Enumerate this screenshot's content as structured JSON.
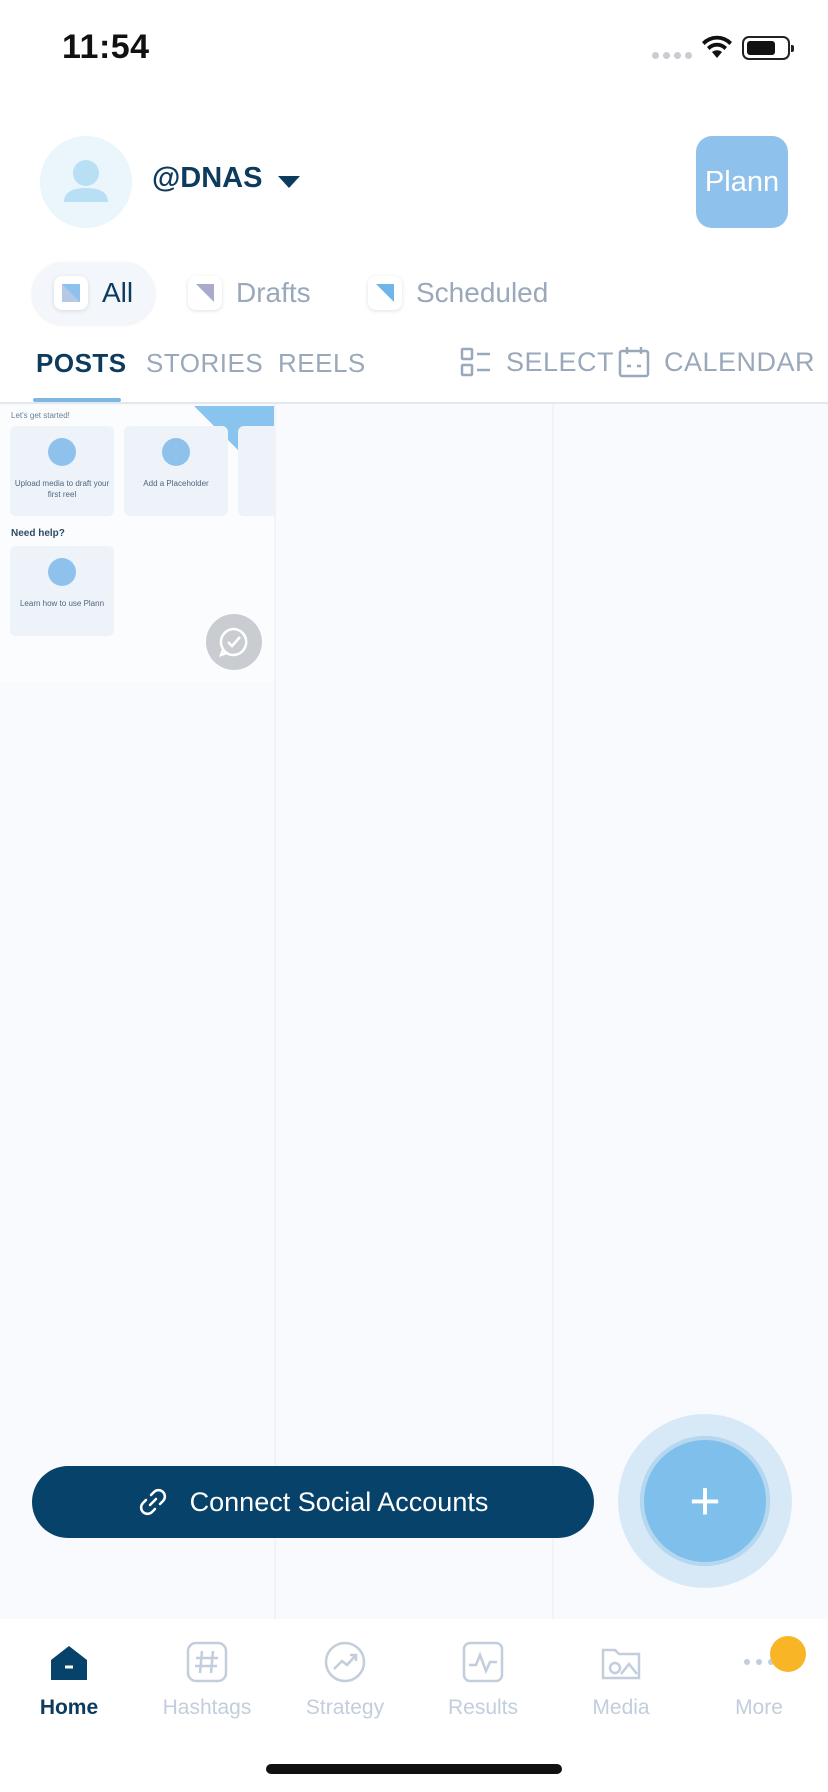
{
  "status_bar": {
    "time": "11:54"
  },
  "header": {
    "handle": "@DNAS",
    "plann_label": "Plann"
  },
  "filters": [
    {
      "label": "All",
      "active": true
    },
    {
      "label": "Drafts",
      "active": false
    },
    {
      "label": "Scheduled",
      "active": false
    }
  ],
  "tabs": [
    {
      "label": "POSTS",
      "active": true
    },
    {
      "label": "STORIES",
      "active": false
    },
    {
      "label": "REELS",
      "active": false
    }
  ],
  "tools": {
    "select": "SELECT",
    "calendar": "CALENDAR"
  },
  "card": {
    "intro": "Let's get started!",
    "tile_upload": "Upload media to draft your first reel",
    "tile_placeholder": "Add a Placeholder",
    "help_heading": "Need help?",
    "tile_learn": "Learn how to use Plann"
  },
  "actions": {
    "connect": "Connect Social Accounts",
    "fab": "+"
  },
  "nav": [
    {
      "label": "Home",
      "icon": "home-icon",
      "active": true
    },
    {
      "label": "Hashtags",
      "icon": "hashtag-icon",
      "active": false
    },
    {
      "label": "Strategy",
      "icon": "trend-icon",
      "active": false
    },
    {
      "label": "Results",
      "icon": "pulse-icon",
      "active": false
    },
    {
      "label": "Media",
      "icon": "media-icon",
      "active": false
    },
    {
      "label": "More",
      "icon": "more-icon",
      "active": false
    }
  ],
  "colors": {
    "primary": "#07426a",
    "accent": "#7fbfec",
    "badge": "#f8b526"
  }
}
